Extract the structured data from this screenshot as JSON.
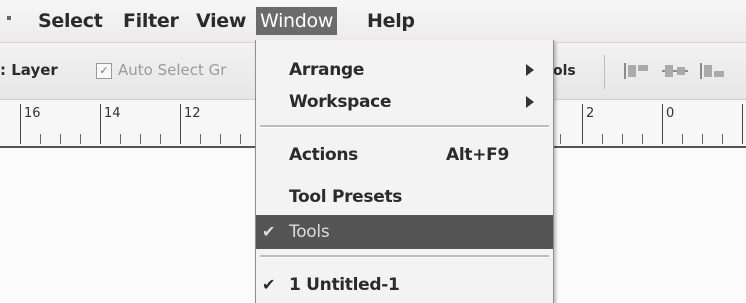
{
  "menubar": {
    "items": [
      {
        "label": "Select"
      },
      {
        "label": "Filter"
      },
      {
        "label": "View"
      },
      {
        "label": "Window"
      },
      {
        "label": "Help"
      }
    ],
    "active_index": 3
  },
  "options_bar": {
    "layer_label": ": Layer",
    "auto_select_label": "Auto Select Gr",
    "auto_select_checked": true,
    "tools_suffix": "ols"
  },
  "ruler": {
    "labels": [
      "16",
      "14",
      "12",
      "2",
      "0"
    ]
  },
  "window_menu": {
    "items": [
      {
        "label": "Arrange",
        "submenu": true
      },
      {
        "label": "Workspace",
        "submenu": true
      },
      {
        "label": "Actions",
        "shortcut": "Alt+F9"
      },
      {
        "label": "Tool Presets"
      },
      {
        "label": "Tools",
        "checked": true,
        "highlighted": true
      },
      {
        "label": "1 Untitled-1",
        "checked": true
      }
    ]
  },
  "icons": {
    "menubar_grip": "grip-dot-icon",
    "checkbox_check": "checkmark-icon",
    "submenu_arrow": "chevron-right-icon",
    "menu_check": "checkmark-icon",
    "align": [
      "align-top-icon",
      "align-vcenter-icon",
      "align-bottom-icon"
    ]
  },
  "colors": {
    "active_menu_bg": "#6b6b6b",
    "highlight_bg": "#545454"
  }
}
